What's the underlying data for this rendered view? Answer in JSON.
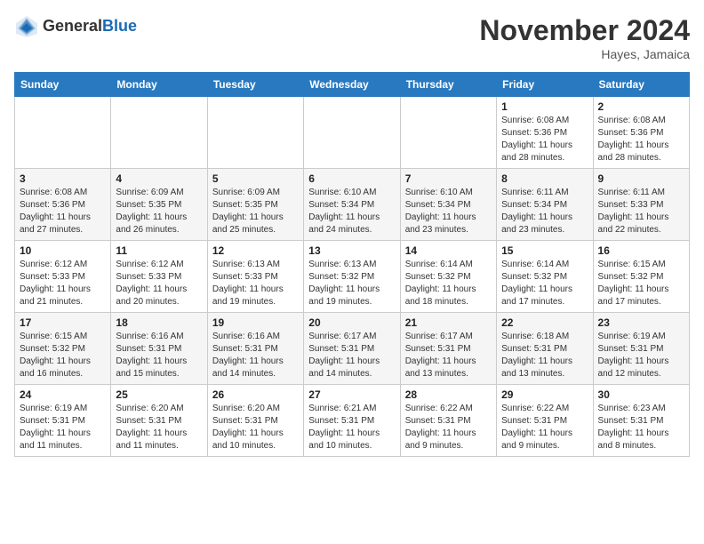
{
  "header": {
    "logo_general": "General",
    "logo_blue": "Blue",
    "month_year": "November 2024",
    "location": "Hayes, Jamaica"
  },
  "weekdays": [
    "Sunday",
    "Monday",
    "Tuesday",
    "Wednesday",
    "Thursday",
    "Friday",
    "Saturday"
  ],
  "weeks": [
    [
      {
        "day": "",
        "empty": true
      },
      {
        "day": "",
        "empty": true
      },
      {
        "day": "",
        "empty": true
      },
      {
        "day": "",
        "empty": true
      },
      {
        "day": "",
        "empty": true
      },
      {
        "day": "1",
        "sunrise": "Sunrise: 6:08 AM",
        "sunset": "Sunset: 5:36 PM",
        "daylight": "Daylight: 11 hours and 28 minutes."
      },
      {
        "day": "2",
        "sunrise": "Sunrise: 6:08 AM",
        "sunset": "Sunset: 5:36 PM",
        "daylight": "Daylight: 11 hours and 28 minutes."
      }
    ],
    [
      {
        "day": "3",
        "sunrise": "Sunrise: 6:08 AM",
        "sunset": "Sunset: 5:36 PM",
        "daylight": "Daylight: 11 hours and 27 minutes."
      },
      {
        "day": "4",
        "sunrise": "Sunrise: 6:09 AM",
        "sunset": "Sunset: 5:35 PM",
        "daylight": "Daylight: 11 hours and 26 minutes."
      },
      {
        "day": "5",
        "sunrise": "Sunrise: 6:09 AM",
        "sunset": "Sunset: 5:35 PM",
        "daylight": "Daylight: 11 hours and 25 minutes."
      },
      {
        "day": "6",
        "sunrise": "Sunrise: 6:10 AM",
        "sunset": "Sunset: 5:34 PM",
        "daylight": "Daylight: 11 hours and 24 minutes."
      },
      {
        "day": "7",
        "sunrise": "Sunrise: 6:10 AM",
        "sunset": "Sunset: 5:34 PM",
        "daylight": "Daylight: 11 hours and 23 minutes."
      },
      {
        "day": "8",
        "sunrise": "Sunrise: 6:11 AM",
        "sunset": "Sunset: 5:34 PM",
        "daylight": "Daylight: 11 hours and 23 minutes."
      },
      {
        "day": "9",
        "sunrise": "Sunrise: 6:11 AM",
        "sunset": "Sunset: 5:33 PM",
        "daylight": "Daylight: 11 hours and 22 minutes."
      }
    ],
    [
      {
        "day": "10",
        "sunrise": "Sunrise: 6:12 AM",
        "sunset": "Sunset: 5:33 PM",
        "daylight": "Daylight: 11 hours and 21 minutes."
      },
      {
        "day": "11",
        "sunrise": "Sunrise: 6:12 AM",
        "sunset": "Sunset: 5:33 PM",
        "daylight": "Daylight: 11 hours and 20 minutes."
      },
      {
        "day": "12",
        "sunrise": "Sunrise: 6:13 AM",
        "sunset": "Sunset: 5:33 PM",
        "daylight": "Daylight: 11 hours and 19 minutes."
      },
      {
        "day": "13",
        "sunrise": "Sunrise: 6:13 AM",
        "sunset": "Sunset: 5:32 PM",
        "daylight": "Daylight: 11 hours and 19 minutes."
      },
      {
        "day": "14",
        "sunrise": "Sunrise: 6:14 AM",
        "sunset": "Sunset: 5:32 PM",
        "daylight": "Daylight: 11 hours and 18 minutes."
      },
      {
        "day": "15",
        "sunrise": "Sunrise: 6:14 AM",
        "sunset": "Sunset: 5:32 PM",
        "daylight": "Daylight: 11 hours and 17 minutes."
      },
      {
        "day": "16",
        "sunrise": "Sunrise: 6:15 AM",
        "sunset": "Sunset: 5:32 PM",
        "daylight": "Daylight: 11 hours and 17 minutes."
      }
    ],
    [
      {
        "day": "17",
        "sunrise": "Sunrise: 6:15 AM",
        "sunset": "Sunset: 5:32 PM",
        "daylight": "Daylight: 11 hours and 16 minutes."
      },
      {
        "day": "18",
        "sunrise": "Sunrise: 6:16 AM",
        "sunset": "Sunset: 5:31 PM",
        "daylight": "Daylight: 11 hours and 15 minutes."
      },
      {
        "day": "19",
        "sunrise": "Sunrise: 6:16 AM",
        "sunset": "Sunset: 5:31 PM",
        "daylight": "Daylight: 11 hours and 14 minutes."
      },
      {
        "day": "20",
        "sunrise": "Sunrise: 6:17 AM",
        "sunset": "Sunset: 5:31 PM",
        "daylight": "Daylight: 11 hours and 14 minutes."
      },
      {
        "day": "21",
        "sunrise": "Sunrise: 6:17 AM",
        "sunset": "Sunset: 5:31 PM",
        "daylight": "Daylight: 11 hours and 13 minutes."
      },
      {
        "day": "22",
        "sunrise": "Sunrise: 6:18 AM",
        "sunset": "Sunset: 5:31 PM",
        "daylight": "Daylight: 11 hours and 13 minutes."
      },
      {
        "day": "23",
        "sunrise": "Sunrise: 6:19 AM",
        "sunset": "Sunset: 5:31 PM",
        "daylight": "Daylight: 11 hours and 12 minutes."
      }
    ],
    [
      {
        "day": "24",
        "sunrise": "Sunrise: 6:19 AM",
        "sunset": "Sunset: 5:31 PM",
        "daylight": "Daylight: 11 hours and 11 minutes."
      },
      {
        "day": "25",
        "sunrise": "Sunrise: 6:20 AM",
        "sunset": "Sunset: 5:31 PM",
        "daylight": "Daylight: 11 hours and 11 minutes."
      },
      {
        "day": "26",
        "sunrise": "Sunrise: 6:20 AM",
        "sunset": "Sunset: 5:31 PM",
        "daylight": "Daylight: 11 hours and 10 minutes."
      },
      {
        "day": "27",
        "sunrise": "Sunrise: 6:21 AM",
        "sunset": "Sunset: 5:31 PM",
        "daylight": "Daylight: 11 hours and 10 minutes."
      },
      {
        "day": "28",
        "sunrise": "Sunrise: 6:22 AM",
        "sunset": "Sunset: 5:31 PM",
        "daylight": "Daylight: 11 hours and 9 minutes."
      },
      {
        "day": "29",
        "sunrise": "Sunrise: 6:22 AM",
        "sunset": "Sunset: 5:31 PM",
        "daylight": "Daylight: 11 hours and 9 minutes."
      },
      {
        "day": "30",
        "sunrise": "Sunrise: 6:23 AM",
        "sunset": "Sunset: 5:31 PM",
        "daylight": "Daylight: 11 hours and 8 minutes."
      }
    ]
  ]
}
